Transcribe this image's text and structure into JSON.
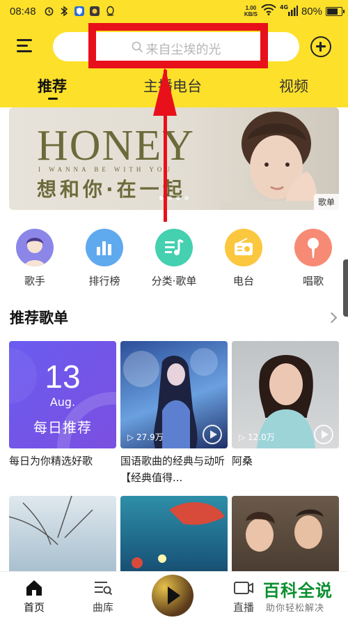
{
  "status_bar": {
    "time": "08:48",
    "net_speed_value": "1.00",
    "net_speed_unit": "KB/S",
    "signal_label": "4G",
    "battery_pct": "80%",
    "battery_level": 0.8
  },
  "header": {
    "search_placeholder": "来自尘埃的光",
    "tabs": [
      {
        "label": "推荐",
        "active": true
      },
      {
        "label": "主播电台",
        "active": false
      },
      {
        "label": "视频",
        "active": false
      }
    ]
  },
  "banner": {
    "title": "HONEY",
    "subtitle": "I WANNA BE WITH YOU",
    "chinese_text": "想和你·在一起",
    "tag": "歌单",
    "dots": 4,
    "active_dot": 0
  },
  "categories": [
    {
      "label": "歌手",
      "icon": "singer-icon",
      "color": "#8b86e8"
    },
    {
      "label": "排行榜",
      "icon": "chart-icon",
      "color": "#5fa9ef"
    },
    {
      "label": "分类·歌单",
      "icon": "playlist-icon",
      "color": "#45d0b0"
    },
    {
      "label": "电台",
      "icon": "radio-icon",
      "color": "#fbc73e"
    },
    {
      "label": "唱歌",
      "icon": "microphone-icon",
      "color": "#f78a74"
    }
  ],
  "section": {
    "title": "推荐歌单",
    "more_icon": "chevron-right-icon"
  },
  "playlists": [
    {
      "title": "每日为你精选好歌",
      "daily_day": "13",
      "daily_month": "Aug.",
      "daily_label": "每日推荐",
      "play_count": ""
    },
    {
      "title": "国语歌曲的经典与动听【经典值得...",
      "play_count": "27.9万"
    },
    {
      "title": "阿桑",
      "play_count": "12.0万"
    },
    {
      "title": "",
      "play_count": ""
    },
    {
      "title": "",
      "play_count": ""
    },
    {
      "title": "",
      "play_count": ""
    }
  ],
  "bottom_nav": [
    {
      "label": "首页",
      "icon": "home-icon",
      "active": true
    },
    {
      "label": "曲库",
      "icon": "library-icon",
      "active": false
    },
    {
      "label": "直播",
      "icon": "live-icon",
      "active": false
    }
  ],
  "watermark": {
    "main": "百科全说",
    "sub": "助你轻松解决"
  },
  "colors": {
    "brand_yellow": "#fde02a",
    "annotation_red": "#e8101a"
  }
}
